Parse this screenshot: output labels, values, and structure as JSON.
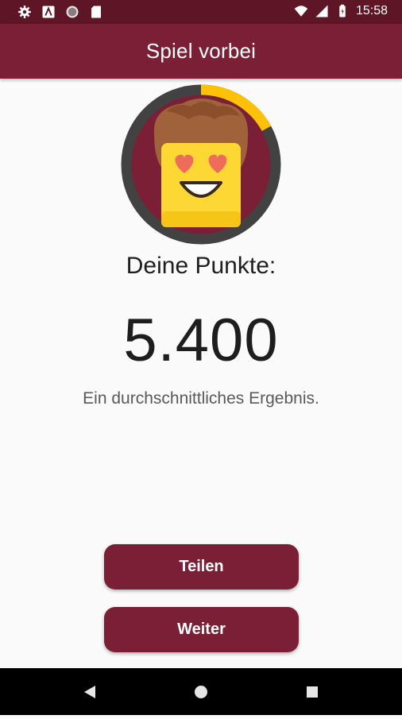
{
  "status_bar": {
    "time": "15:58",
    "left_icons": [
      "settings-icon",
      "app-notification-icon",
      "circle-notification-icon",
      "sd-card-icon"
    ],
    "right_icons": [
      "wifi-icon",
      "cell-signal-icon",
      "battery-icon"
    ]
  },
  "app_bar": {
    "title": "Spiel vorbei"
  },
  "avatar": {
    "icon": "heart-eyes-face-icon",
    "progress_fraction": 0.17,
    "progress_color": "#ffc107",
    "ring_color": "#424242",
    "inner_color": "#7b1f37"
  },
  "result": {
    "score_label": "Deine Punkte:",
    "score_value": "5.400",
    "message": "Ein durchschnittliches Ergebnis."
  },
  "buttons": {
    "share_label": "Teilen",
    "next_label": "Weiter"
  },
  "nav_bar": {
    "back": "back-icon",
    "home": "home-icon",
    "recents": "recents-icon"
  },
  "colors": {
    "primary": "#7b1f37",
    "primary_dark": "#5e1526",
    "accent": "#ffc107"
  }
}
